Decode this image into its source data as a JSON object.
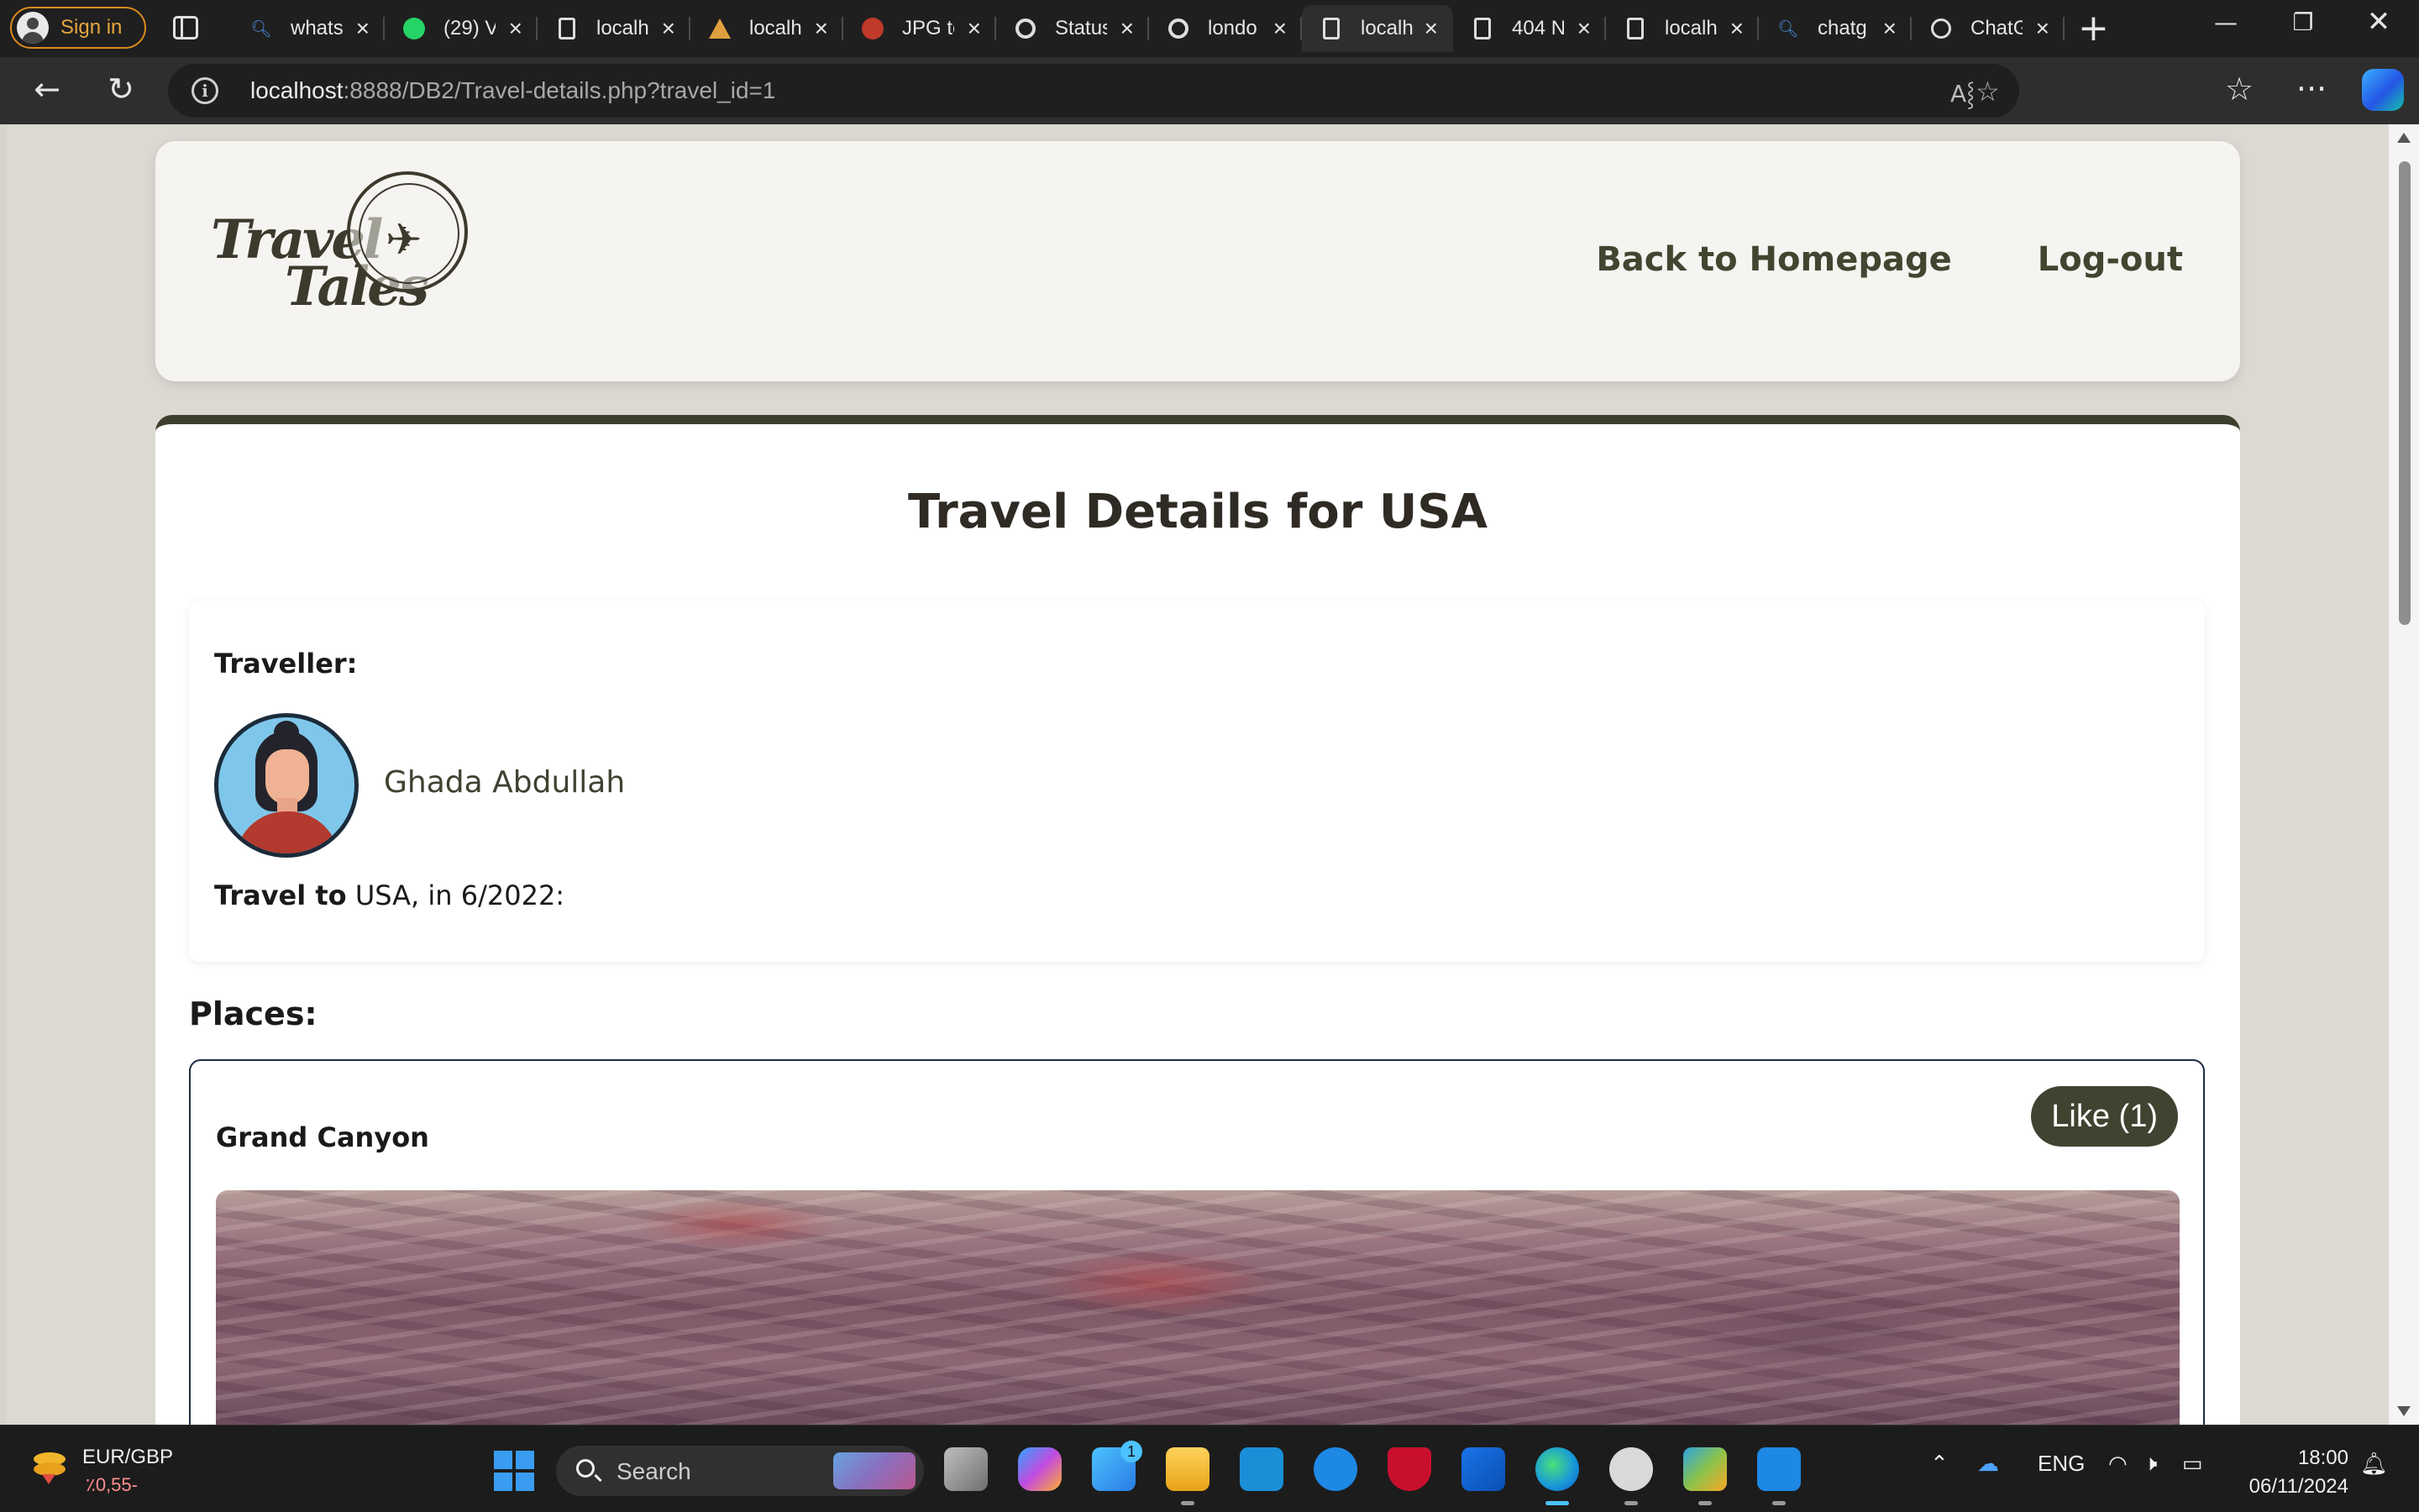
{
  "browser": {
    "signin_label": "Sign in",
    "tabs": [
      {
        "title": "whats",
        "icon": "search-icon"
      },
      {
        "title": "(29) V",
        "icon": "whatsapp-icon"
      },
      {
        "title": "localh",
        "icon": "page-icon"
      },
      {
        "title": "localh",
        "icon": "mamp-icon"
      },
      {
        "title": "JPG to",
        "icon": "converter-icon"
      },
      {
        "title": "Status",
        "icon": "google-icon"
      },
      {
        "title": "londo",
        "icon": "google-icon"
      },
      {
        "title": "localh",
        "icon": "page-icon"
      },
      {
        "title": "404 N",
        "icon": "page-icon"
      },
      {
        "title": "localh",
        "icon": "page-icon"
      },
      {
        "title": "chatg",
        "icon": "search-icon"
      },
      {
        "title": "ChatG",
        "icon": "chatgpt-icon"
      }
    ],
    "url_host": "localhost",
    "url_rest": ":8888/DB2/Travel-details.php?travel_id=1"
  },
  "site": {
    "logo_word1": "Travel",
    "logo_word2": "Tales",
    "nav": {
      "home": "Back to Homepage",
      "logout": "Log-out"
    }
  },
  "details": {
    "title": "Travel Details for USA",
    "traveller_label": "Traveller:",
    "traveller_name": "Ghada Abdullah",
    "travel_prefix": "Travel to",
    "travel_rest": " USA, in 6/2022:",
    "places_label": "Places:",
    "places": [
      {
        "name": "Grand Canyon",
        "like_label": "Like (1)"
      }
    ]
  },
  "taskbar": {
    "widget_pair": "EUR/GBP",
    "widget_change": "٪0,55-",
    "search_placeholder": "Search",
    "store_badge": "1",
    "lang": "ENG",
    "time": "18:00",
    "date": "06/11/2024"
  },
  "colors": {
    "accent": "#3e4430",
    "nav_text": "#424530",
    "tab_bar": "#1f1f1f",
    "taskbar": "#1c1c1c"
  }
}
